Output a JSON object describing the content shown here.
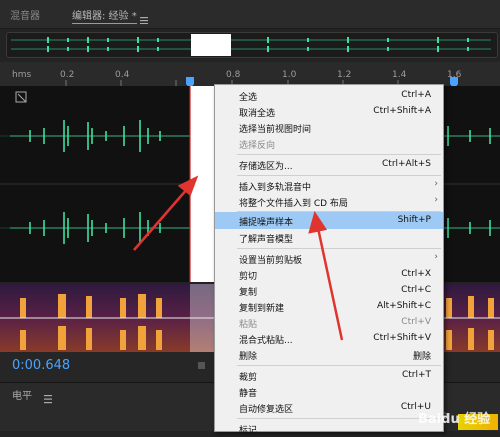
{
  "tabs": {
    "mixer": "混音器",
    "editor": "编辑器: 经验 *",
    "menu_icon": "hamburger-icon"
  },
  "ruler": {
    "unit": "hms",
    "ticks": [
      "0.2",
      "0.4",
      "0.8",
      "1.0",
      "1.2",
      "1.4",
      "1.6",
      "1.8"
    ]
  },
  "timecode": "0:00.648",
  "level_label": "电平",
  "level_value": "0",
  "colors": {
    "accent": "#4aa3ff",
    "waveform": "#3fdf9f",
    "selection": "#ffffff",
    "highlight": "#9ec9f4",
    "arrow": "#e0342e"
  },
  "menu": {
    "items": [
      {
        "label": "全选",
        "shortcut": "Ctrl+A"
      },
      {
        "label": "取消全选",
        "shortcut": "Ctrl+Shift+A"
      },
      {
        "label": "选择当前视图时间",
        "shortcut": ""
      },
      {
        "label": "选择反向",
        "shortcut": ""
      },
      {
        "label": "存储选区为...",
        "shortcut": "Ctrl+Alt+S"
      },
      {
        "label": "插入到多轨混音中",
        "shortcut": ""
      },
      {
        "label": "将整个文件插入到 CD 布局",
        "shortcut": ""
      },
      {
        "label": "捕捉噪声样本",
        "shortcut": "Shift+P"
      },
      {
        "label": "了解声音模型",
        "shortcut": ""
      },
      {
        "label": "设置当前剪贴板",
        "shortcut": ""
      },
      {
        "label": "剪切",
        "shortcut": "Ctrl+X"
      },
      {
        "label": "复制",
        "shortcut": "Ctrl+C"
      },
      {
        "label": "复制到新建",
        "shortcut": "Alt+Shift+C"
      },
      {
        "label": "粘贴",
        "shortcut": "Ctrl+V"
      },
      {
        "label": "混合式粘贴...",
        "shortcut": "Ctrl+Shift+V"
      },
      {
        "label": "删除",
        "shortcut": "删除"
      },
      {
        "label": "裁剪",
        "shortcut": "Ctrl+T"
      },
      {
        "label": "静音",
        "shortcut": ""
      },
      {
        "label": "自动修复选区",
        "shortcut": "Ctrl+U"
      },
      {
        "label": "标记",
        "shortcut": ""
      }
    ]
  },
  "watermark": "Baidu 经验"
}
